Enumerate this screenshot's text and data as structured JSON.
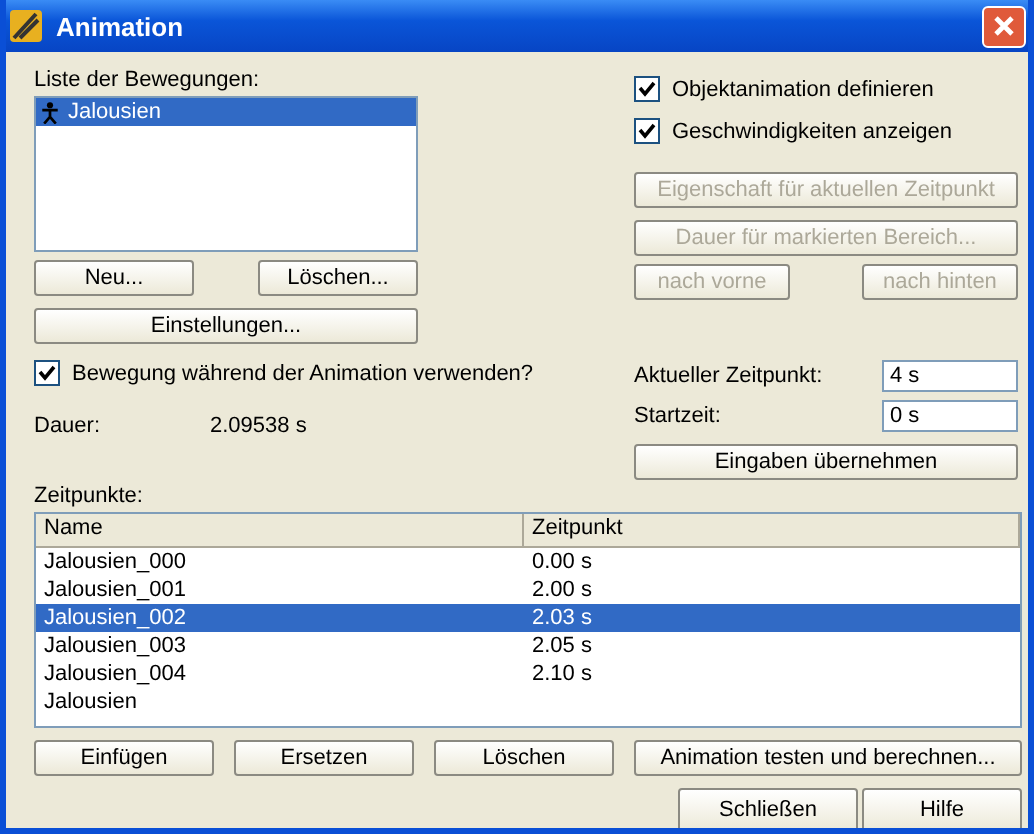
{
  "window": {
    "title": "Animation"
  },
  "motions": {
    "label": "Liste der Bewegungen:",
    "items": [
      {
        "name": "Jalousien",
        "selected": true
      }
    ]
  },
  "motion_buttons": [
    "Neu...",
    "Löschen..."
  ],
  "settings_button": "Einstellungen...",
  "use_motion": {
    "label": "Bewegung während der Animation verwenden?",
    "checked": true
  },
  "duration": {
    "label": "Dauer:",
    "value": "2.09538 s"
  },
  "options": [
    {
      "label": "Objektanimation definieren",
      "checked": true
    },
    {
      "label": "Geschwindigkeiten anzeigen",
      "checked": true
    }
  ],
  "side_buttons": [
    {
      "label": "Eigenschaft für aktuellen Zeitpunkt",
      "disabled": true
    },
    {
      "label": "Dauer für markierten Bereich...",
      "disabled": true
    }
  ],
  "order_buttons": [
    {
      "label": "nach vorne",
      "disabled": true
    },
    {
      "label": "nach hinten",
      "disabled": true
    }
  ],
  "current_time": {
    "label": "Aktueller Zeitpunkt:",
    "value": "4 s"
  },
  "start_time": {
    "label": "Startzeit:",
    "value": "0 s"
  },
  "apply_button": "Eingaben übernehmen",
  "keyframes": {
    "label": "Zeitpunkte:",
    "columns": [
      "Name",
      "Zeitpunkt"
    ],
    "rows": [
      {
        "name": "Jalousien_000",
        "time": "0.00 s",
        "selected": false
      },
      {
        "name": "Jalousien_001",
        "time": "2.00 s",
        "selected": false
      },
      {
        "name": "Jalousien_002",
        "time": "2.03 s",
        "selected": true
      },
      {
        "name": "Jalousien_003",
        "time": "2.05 s",
        "selected": false
      },
      {
        "name": "Jalousien_004",
        "time": "2.10 s",
        "selected": false
      },
      {
        "name": "Jalousien",
        "time": "",
        "selected": false
      }
    ]
  },
  "row_buttons": [
    "Einfügen",
    "Ersetzen",
    "Löschen",
    "Animation testen und berechnen..."
  ],
  "footer_buttons": [
    "Schließen",
    "Hilfe"
  ]
}
